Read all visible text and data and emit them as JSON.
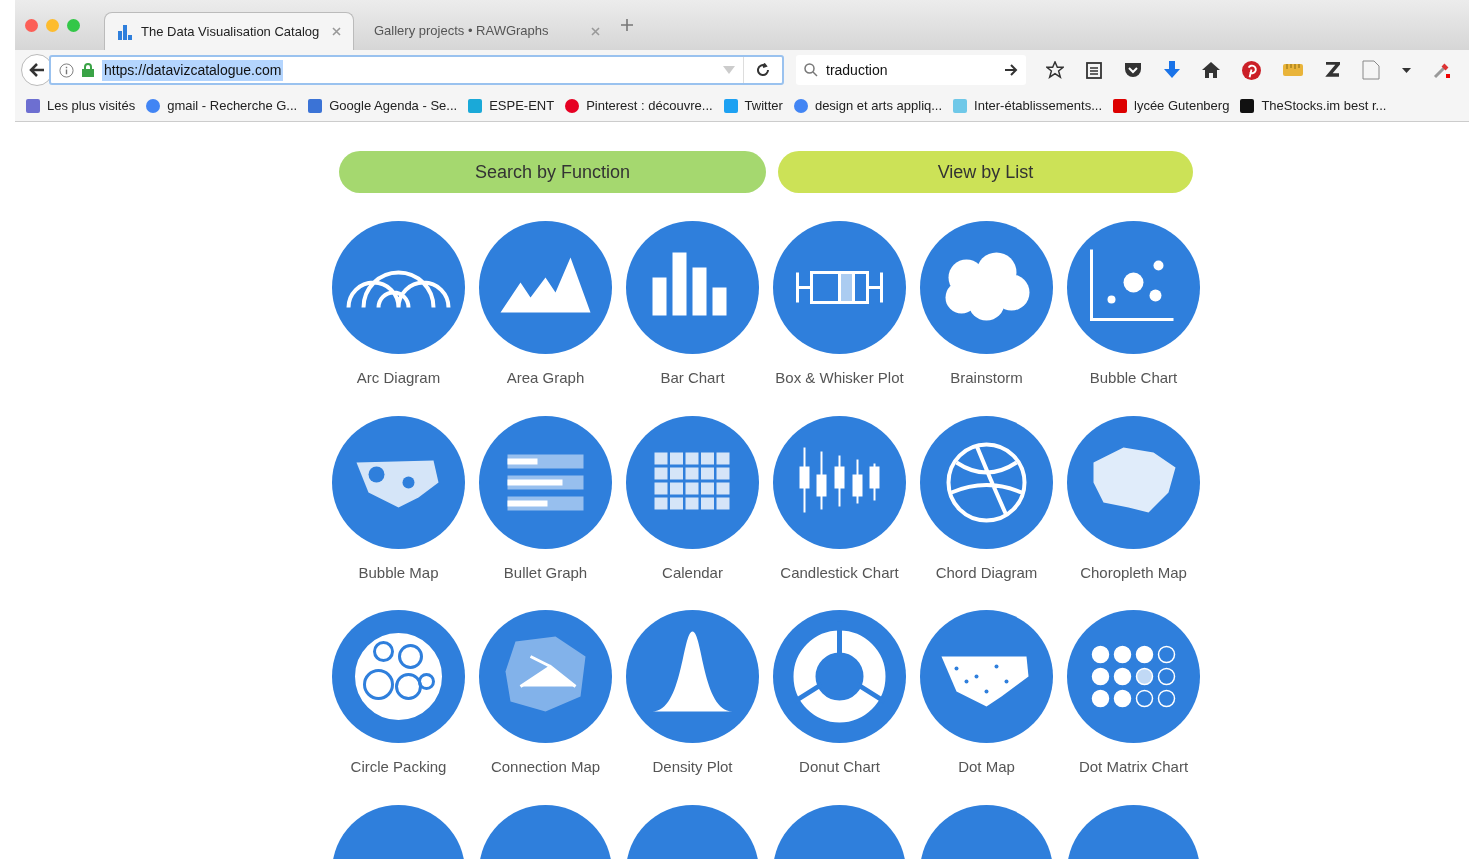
{
  "tabs": [
    {
      "title": "The Data Visualisation Catalog",
      "selected": true
    },
    {
      "title": "Gallery projects • RAWGraphs",
      "selected": false
    }
  ],
  "address_bar": {
    "url": "https://datavizcatalogue.com"
  },
  "search_field": {
    "value": "traduction"
  },
  "bookmarks": [
    "Les plus visités",
    "gmail - Recherche G...",
    "Google Agenda - Se...",
    "ESPE-ENT",
    "Pinterest : découvre...",
    "Twitter",
    "design et arts appliq...",
    "Inter-établissements...",
    "lycée Gutenberg",
    "TheStocks.im best r..."
  ],
  "page": {
    "buttons": [
      {
        "label": "Search by Function",
        "color": "#a5d86f"
      },
      {
        "label": "View by List",
        "color": "#cce257"
      }
    ],
    "charts": [
      "Arc Diagram",
      "Area Graph",
      "Bar Chart",
      "Box & Whisker Plot",
      "Brainstorm",
      "Bubble Chart",
      "Bubble Map",
      "Bullet Graph",
      "Calendar",
      "Candlestick Chart",
      "Chord Diagram",
      "Choropleth Map",
      "Circle Packing",
      "Connection Map",
      "Density Plot",
      "Donut Chart",
      "Dot Map",
      "Dot Matrix Chart"
    ]
  }
}
